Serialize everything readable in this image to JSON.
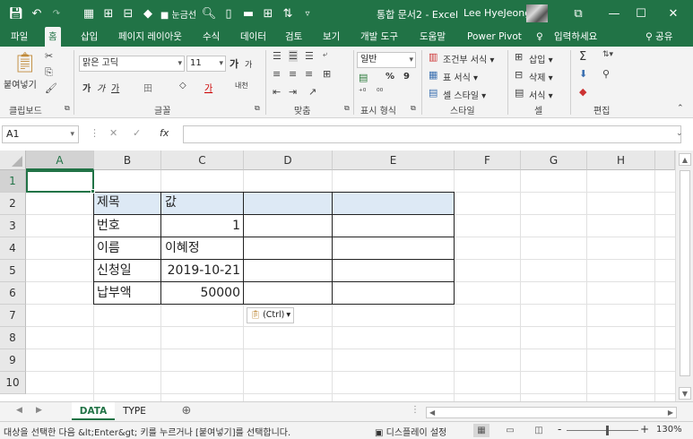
{
  "titlebar": {
    "doc_title": "통합 문서2 - Excel",
    "user": "Lee HyeJeong",
    "window_buttons": [
      "⧉",
      "—",
      "☐",
      "✕"
    ]
  },
  "ribbon_tabs": [
    "파일",
    "홈",
    "삽입",
    "페이지 레이아웃",
    "수식",
    "데이터",
    "검토",
    "보기",
    "개발 도구",
    "도움말",
    "Power Pivot",
    "입력하세요"
  ],
  "active_tab": "홈",
  "share_label": "공유",
  "ribbon": {
    "clipboard": {
      "paste": "붙여넣기",
      "label": "클립보드"
    },
    "font": {
      "name": "맑은 고딕",
      "size": "11",
      "label": "글꼴",
      "size_up": "가",
      "size_down": "가",
      "bold": "가",
      "italic": "가",
      "underline": "가",
      "border": "田",
      "fill": "◇",
      "color": "가",
      "phonetic": "내천"
    },
    "alignment": {
      "label": "맞춤"
    },
    "number": {
      "format": "일반",
      "percent": "%",
      "comma": "9",
      "label": "표시 형식"
    },
    "styles": {
      "conditional": "조건부 서식",
      "table": "표 서식",
      "cell_style": "셀 스타일",
      "label": "스타일"
    },
    "cells": {
      "insert": "삽입",
      "delete": "삭제",
      "format": "서식",
      "label": "셀"
    },
    "editing": {
      "sum": "Σ",
      "label": "편집"
    }
  },
  "formula_bar": {
    "name_box": "A1",
    "cancel": "✕",
    "enter": "✓",
    "fx": "fx",
    "value": ""
  },
  "columns": [
    "A",
    "B",
    "C",
    "D",
    "E",
    "F",
    "G",
    "H"
  ],
  "rows": [
    "1",
    "2",
    "3",
    "4",
    "5",
    "6",
    "7",
    "8",
    "9",
    "10"
  ],
  "cells": {
    "B2": "제목",
    "C2": "값",
    "B3": "번호",
    "C3": "1",
    "B4": "이름",
    "C4": "이혜정",
    "B5": "신청일",
    "C5": "2019-10-21",
    "B6": "납부액",
    "C6": "50000"
  },
  "paste_options": "(Ctrl)",
  "sheets": [
    "DATA",
    "TYPE"
  ],
  "active_sheet": "DATA",
  "statusbar": {
    "message": "대상을 선택한 다음 &lt;Enter&gt; 키를 누르거나 [붙여넣기]를 선택합니다.",
    "display_settings": "디스플레이 설정",
    "zoom": "130%",
    "zoom_minus": "-",
    "zoom_plus": "+"
  },
  "colors": {
    "excel_green": "#217346",
    "header_fill": "#dde9f5"
  }
}
